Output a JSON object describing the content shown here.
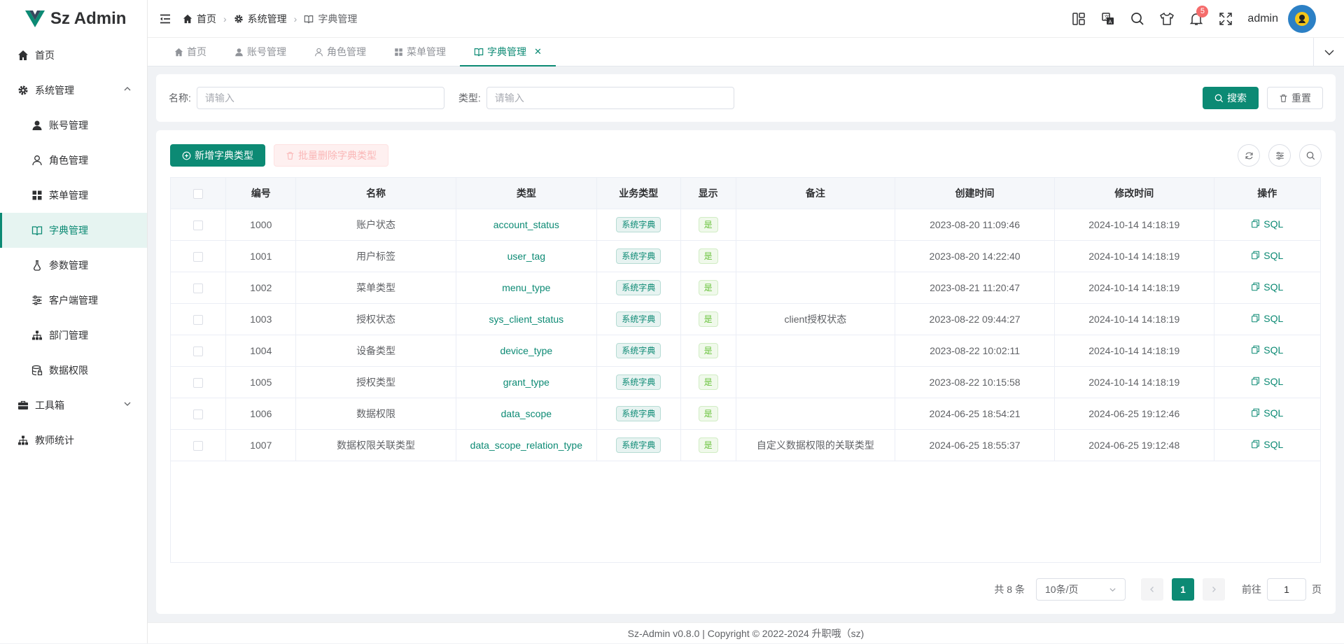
{
  "app": {
    "title": "Sz Admin",
    "brand_color": "#0c8a74"
  },
  "sidebar": {
    "items": [
      {
        "label": "首页",
        "icon": "home-icon"
      },
      {
        "label": "系统管理",
        "icon": "gear-icon"
      },
      {
        "label": "账号管理",
        "icon": "user-solid-icon"
      },
      {
        "label": "角色管理",
        "icon": "user-outline-icon"
      },
      {
        "label": "菜单管理",
        "icon": "grid-icon"
      },
      {
        "label": "字典管理",
        "icon": "book-icon"
      },
      {
        "label": "参数管理",
        "icon": "flask-icon"
      },
      {
        "label": "客户端管理",
        "icon": "sliders-icon"
      },
      {
        "label": "部门管理",
        "icon": "org-icon"
      },
      {
        "label": "数据权限",
        "icon": "database-lock-icon"
      },
      {
        "label": "工具箱",
        "icon": "briefcase-icon"
      },
      {
        "label": "教师统计",
        "icon": "org-icon"
      }
    ]
  },
  "breadcrumb": [
    "首页",
    "系统管理",
    "字典管理"
  ],
  "header": {
    "username": "admin",
    "notifications": "5"
  },
  "tabs": [
    "首页",
    "账号管理",
    "角色管理",
    "菜单管理",
    "字典管理"
  ],
  "search": {
    "name_label": "名称:",
    "name_placeholder": "请输入",
    "type_label": "类型:",
    "type_placeholder": "请输入",
    "search_btn": "搜索",
    "reset_btn": "重置"
  },
  "toolbar": {
    "add": "新增字典类型",
    "batch_delete": "批量删除字典类型"
  },
  "table": {
    "columns": [
      "编号",
      "名称",
      "类型",
      "业务类型",
      "显示",
      "备注",
      "创建时间",
      "修改时间",
      "操作"
    ],
    "rows": [
      {
        "id": "1000",
        "name": "账户状态",
        "type": "account_status",
        "biz": "系统字典",
        "show": "是",
        "remark": "",
        "created": "2023-08-20 11:09:46",
        "updated": "2024-10-14 14:18:19",
        "op": "SQL"
      },
      {
        "id": "1001",
        "name": "用户标签",
        "type": "user_tag",
        "biz": "系统字典",
        "show": "是",
        "remark": "",
        "created": "2023-08-20 14:22:40",
        "updated": "2024-10-14 14:18:19",
        "op": "SQL"
      },
      {
        "id": "1002",
        "name": "菜单类型",
        "type": "menu_type",
        "biz": "系统字典",
        "show": "是",
        "remark": "",
        "created": "2023-08-21 11:20:47",
        "updated": "2024-10-14 14:18:19",
        "op": "SQL"
      },
      {
        "id": "1003",
        "name": "授权状态",
        "type": "sys_client_status",
        "biz": "系统字典",
        "show": "是",
        "remark": "client授权状态",
        "created": "2023-08-22 09:44:27",
        "updated": "2024-10-14 14:18:19",
        "op": "SQL"
      },
      {
        "id": "1004",
        "name": "设备类型",
        "type": "device_type",
        "biz": "系统字典",
        "show": "是",
        "remark": "",
        "created": "2023-08-22 10:02:11",
        "updated": "2024-10-14 14:18:19",
        "op": "SQL"
      },
      {
        "id": "1005",
        "name": "授权类型",
        "type": "grant_type",
        "biz": "系统字典",
        "show": "是",
        "remark": "",
        "created": "2023-08-22 10:15:58",
        "updated": "2024-10-14 14:18:19",
        "op": "SQL"
      },
      {
        "id": "1006",
        "name": "数据权限",
        "type": "data_scope",
        "biz": "系统字典",
        "show": "是",
        "remark": "",
        "created": "2024-06-25 18:54:21",
        "updated": "2024-06-25 19:12:46",
        "op": "SQL"
      },
      {
        "id": "1007",
        "name": "数据权限关联类型",
        "type": "data_scope_relation_type",
        "biz": "系统字典",
        "show": "是",
        "remark": "自定义数据权限的关联类型",
        "created": "2024-06-25 18:55:37",
        "updated": "2024-06-25 19:12:48",
        "op": "SQL"
      }
    ]
  },
  "pagination": {
    "total": "共 8 条",
    "page_size": "10条/页",
    "current": "1",
    "goto_label": "前往",
    "goto_value": "1",
    "page_suffix": "页"
  },
  "footer": "Sz-Admin v0.8.0 | Copyright © 2022-2024 升职哦（sz)"
}
